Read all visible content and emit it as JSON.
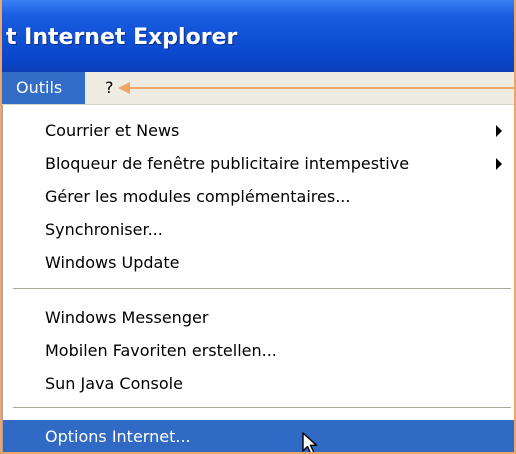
{
  "window": {
    "title": "t Internet Explorer"
  },
  "menubar": {
    "tools_label": "Outils",
    "help_label": "?"
  },
  "menu": {
    "group1": [
      {
        "label": "Courrier et News",
        "submenu": true
      },
      {
        "label": "Bloqueur de fenêtre publicitaire intempestive",
        "submenu": true
      },
      {
        "label": "Gérer les modules complémentaires...",
        "submenu": false
      },
      {
        "label": "Synchroniser...",
        "submenu": false
      },
      {
        "label": "Windows Update",
        "submenu": false
      }
    ],
    "group2": [
      {
        "label": "Windows Messenger",
        "submenu": false
      },
      {
        "label": "Mobilen Favoriten erstellen...",
        "submenu": false
      },
      {
        "label": "Sun Java Console",
        "submenu": false
      }
    ],
    "group3": [
      {
        "label": "Options Internet...",
        "submenu": false,
        "selected": true
      }
    ]
  },
  "colors": {
    "titlebar": "#0f4fd4",
    "selection": "#316ac5",
    "annotation_arrow": "#f0a46a",
    "menubar": "#efede2"
  }
}
